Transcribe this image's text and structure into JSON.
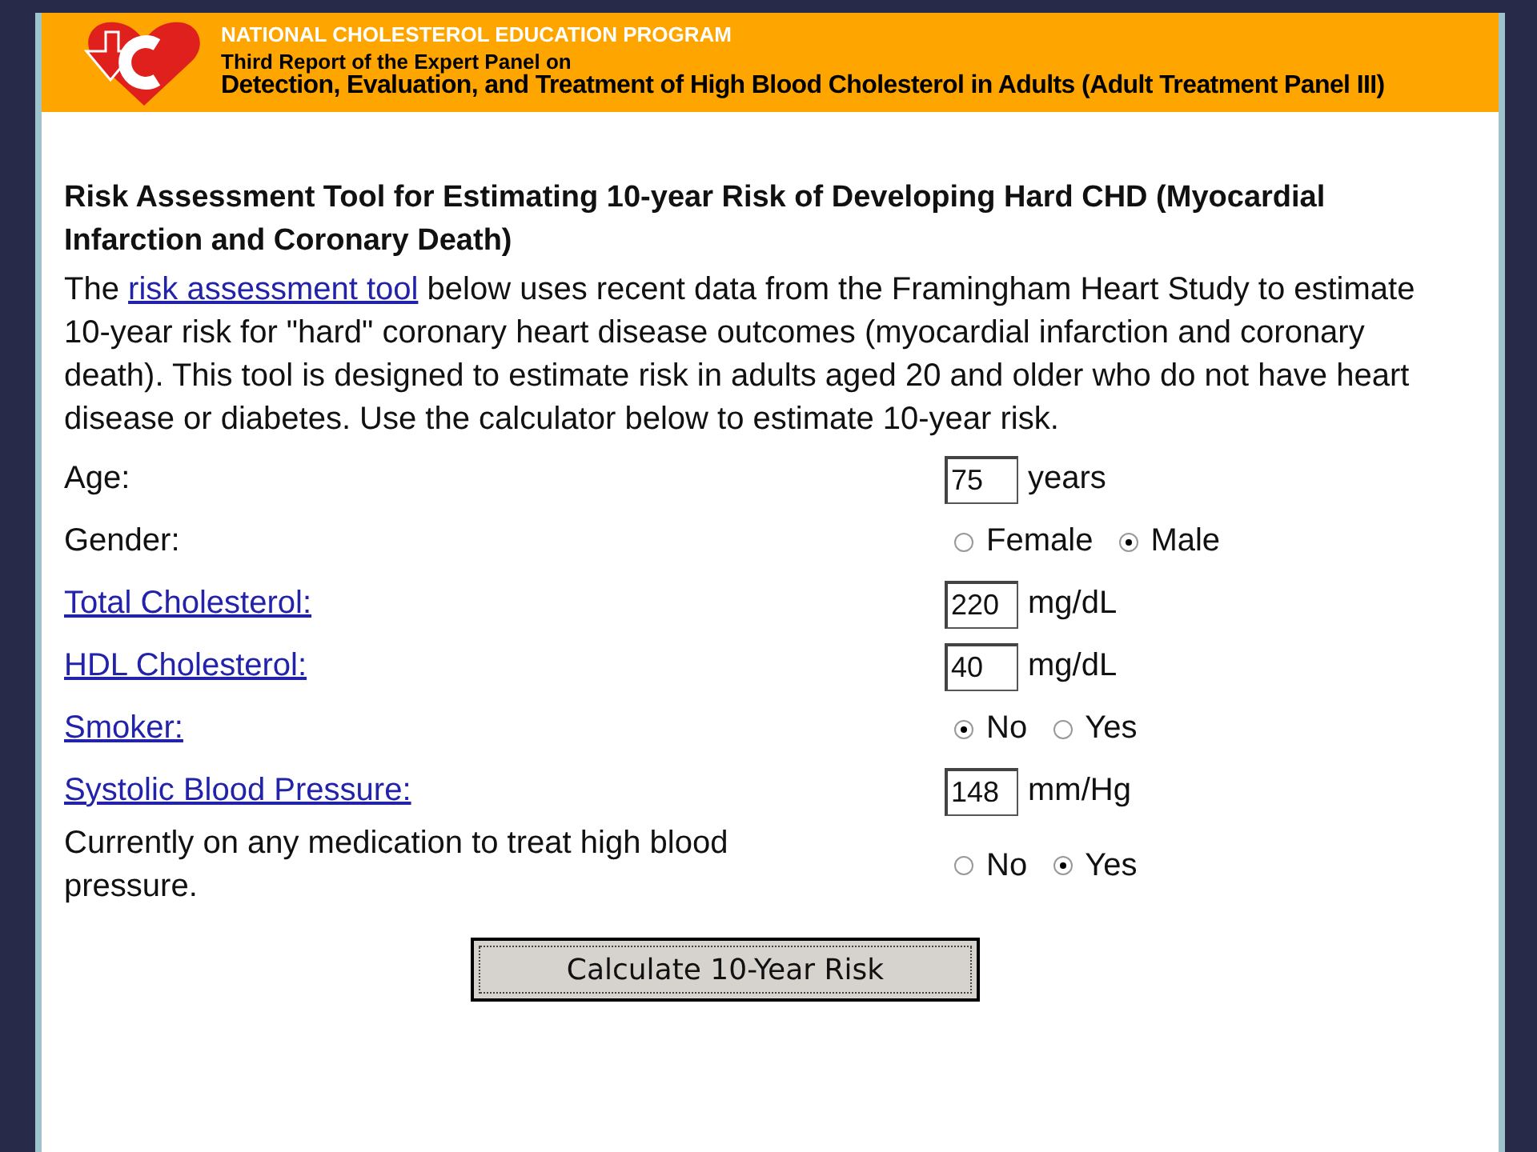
{
  "header": {
    "program": "NATIONAL CHOLESTEROL EDUCATION PROGRAM",
    "subtitle": "Third Report of the Expert Panel on",
    "title": "Detection, Evaluation, and Treatment of High Blood Cholesterol in Adults (Adult Treatment Panel III)"
  },
  "heading": "Risk Assessment Tool for Estimating 10-year Risk of Developing Hard CHD (Myocardial Infarction and Coronary Death)",
  "intro": {
    "before": "The ",
    "link": "risk assessment tool",
    "after": " below uses recent data from the Framingham Heart Study to estimate 10-year risk for \"hard\" coronary heart disease outcomes (myocardial infarction and coronary death). This tool is designed to estimate risk in adults aged 20 and older who do not have heart disease or diabetes. Use the calculator below to estimate 10-year risk."
  },
  "fields": [
    {
      "label": "Age:",
      "link": false,
      "kind": "input",
      "value": "75",
      "unit": "years"
    },
    {
      "label": "Gender:",
      "link": false,
      "kind": "radio",
      "options": [
        {
          "label": "Female",
          "selected": false
        },
        {
          "label": "Male",
          "selected": true
        }
      ]
    },
    {
      "label": "Total Cholesterol:",
      "link": true,
      "kind": "input",
      "value": "220",
      "unit": "mg/dL"
    },
    {
      "label": "HDL Cholesterol:",
      "link": true,
      "kind": "input",
      "value": "40",
      "unit": "mg/dL"
    },
    {
      "label": "Smoker:",
      "link": true,
      "kind": "radio",
      "options": [
        {
          "label": "No",
          "selected": true
        },
        {
          "label": "Yes",
          "selected": false
        }
      ]
    },
    {
      "label": "Systolic Blood Pressure:",
      "link": true,
      "kind": "input",
      "value": "148",
      "unit": "mm/Hg"
    },
    {
      "label": "Currently on any medication to treat high blood pressure.",
      "link": false,
      "kind": "radio",
      "options": [
        {
          "label": "No",
          "selected": false
        },
        {
          "label": "Yes",
          "selected": true
        }
      ]
    }
  ],
  "button": "Calculate  10-Year Risk"
}
